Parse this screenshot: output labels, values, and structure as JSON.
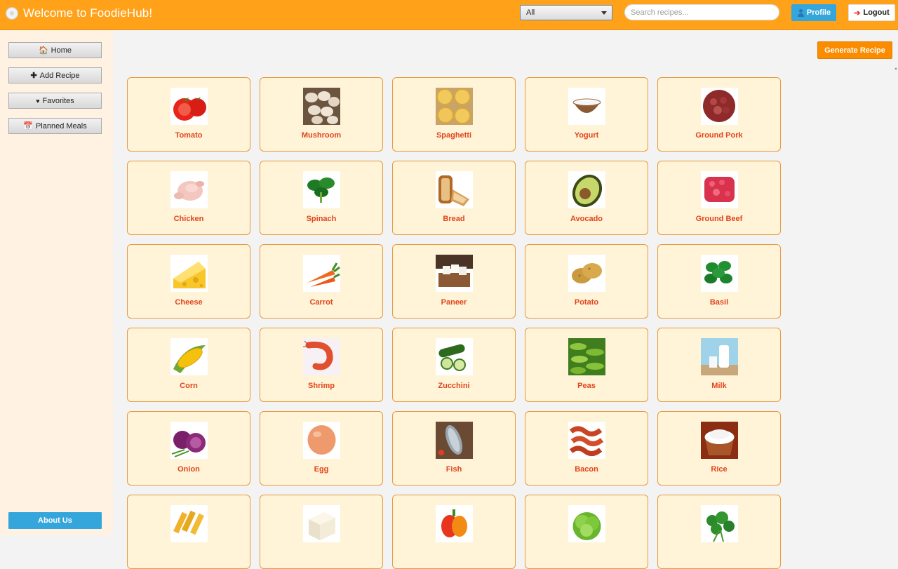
{
  "header": {
    "title": "Welcome to FoodieHub!",
    "app_icon": "plate-icon",
    "category_select": {
      "value": "All"
    },
    "search": {
      "placeholder": "Search recipes..."
    },
    "profile_label": "Profile",
    "logout_label": "Logout"
  },
  "sidebar": {
    "items": [
      {
        "label": "Home",
        "icon": "house-icon"
      },
      {
        "label": "Add Recipe",
        "icon": "plus-icon"
      },
      {
        "label": "Favorites",
        "icon": "heart-icon"
      },
      {
        "label": "Planned Meals",
        "icon": "calendar-icon"
      }
    ],
    "about_label": "About Us"
  },
  "main": {
    "generate_label": "Generate Recipe",
    "ingredients": [
      {
        "name": "Tomato"
      },
      {
        "name": "Mushroom"
      },
      {
        "name": "Spaghetti"
      },
      {
        "name": "Yogurt"
      },
      {
        "name": "Ground Pork"
      },
      {
        "name": "Chicken"
      },
      {
        "name": "Spinach"
      },
      {
        "name": "Bread"
      },
      {
        "name": "Avocado"
      },
      {
        "name": "Ground Beef"
      },
      {
        "name": "Cheese"
      },
      {
        "name": "Carrot"
      },
      {
        "name": "Paneer"
      },
      {
        "name": "Potato"
      },
      {
        "name": "Basil"
      },
      {
        "name": "Corn"
      },
      {
        "name": "Shrimp"
      },
      {
        "name": "Zucchini"
      },
      {
        "name": "Peas"
      },
      {
        "name": "Milk"
      },
      {
        "name": "Onion"
      },
      {
        "name": "Egg"
      },
      {
        "name": "Fish"
      },
      {
        "name": "Bacon"
      },
      {
        "name": "Rice"
      },
      {
        "name": ""
      },
      {
        "name": ""
      },
      {
        "name": ""
      },
      {
        "name": ""
      },
      {
        "name": ""
      }
    ]
  }
}
